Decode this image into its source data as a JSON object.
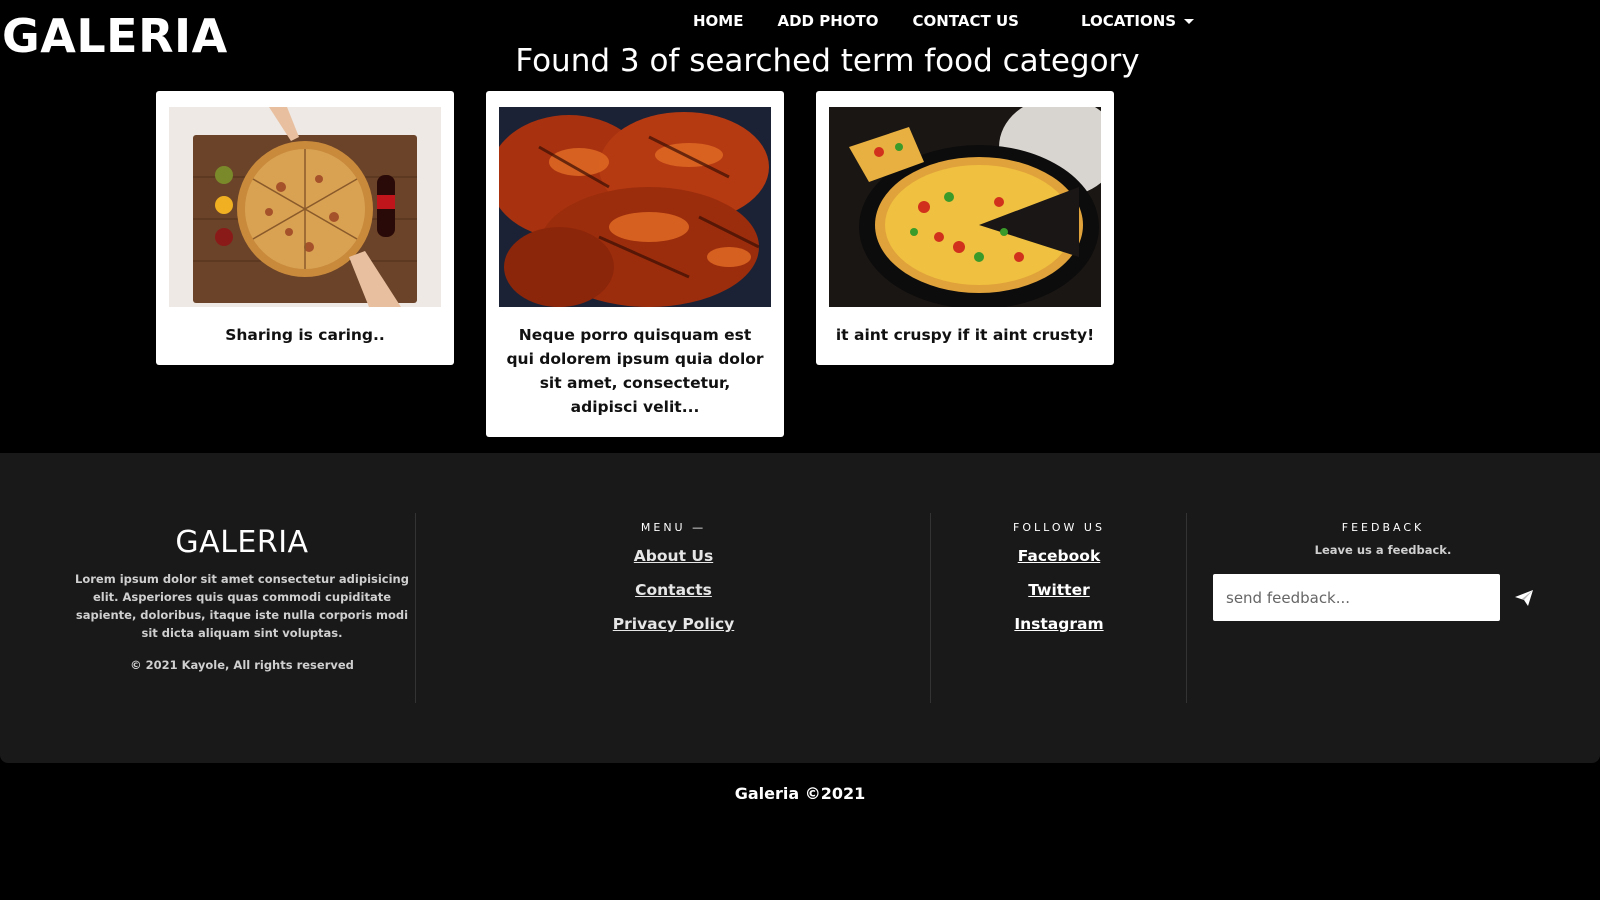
{
  "brand": "GALERIA",
  "nav": {
    "home": "HOME",
    "add_photo": "ADD PHOTO",
    "contact_us": "CONTACT US",
    "locations": "LOCATIONS"
  },
  "search_result_title": "Found 3 of searched term food category",
  "cards": [
    {
      "caption": "Sharing is caring..",
      "image": "pizza-sharing-photo"
    },
    {
      "caption": "Neque porro quisquam est qui dolorem ipsum quia dolor sit amet, consectetur, adipisci velit...",
      "image": "grilled-chicken-photo"
    },
    {
      "caption": "it aint cruspy if it aint crusty!",
      "image": "pan-pizza-photo"
    }
  ],
  "footer": {
    "brand": "GALERIA",
    "description": "Lorem ipsum dolor sit amet consectetur adipisicing elit. Asperiores quis quas commodi cupiditate sapiente, doloribus, itaque iste nulla corporis modi sit dicta aliquam sint voluptas.",
    "copyright": "© 2021 Kayole, All rights reserved",
    "menu": {
      "heading": "MENU —",
      "links": [
        "About Us",
        "Contacts",
        "Privacy Policy"
      ]
    },
    "follow": {
      "heading": "FOLLOW US",
      "links": [
        "Facebook",
        "Twitter",
        "Instagram"
      ]
    },
    "feedback": {
      "heading": "FEEDBACK",
      "subtext": "Leave us a feedback.",
      "placeholder": "send feedback...",
      "send_icon": "paper-plane-icon"
    }
  },
  "bottom_copyright": "Galeria ©2021",
  "colors": {
    "page_bg": "#000000",
    "footer_bg": "#191919",
    "card_bg": "#ffffff"
  }
}
